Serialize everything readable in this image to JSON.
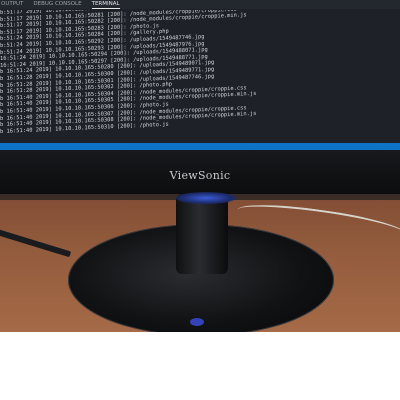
{
  "terminal": {
    "tabs": [
      "OUTPUT",
      "DEBUG CONSOLE",
      "TERMINAL"
    ],
    "active_tab": "TERMINAL",
    "lines": [
      "b:51:17 2019] 10.10.10.165:50280 [200]: /photo.js",
      "b:51:17 2019] 10.10.10.165:50281 [200]: /node_modules/croppie/croppie.css",
      "b:51:17 2019] 10.10.10.165:50282 [200]: /node_modules/croppie/croppie.min.js",
      "b:51:17 2019] 10.10.10.165:50283 [200]: /photo.js",
      "b:51:24 2019] 10.10.10.165:50284 [200]: /gallery.php",
      "b:51:24 2019] 10.10.10.165:50292 [200]: /uploads/1549487746.jpg",
      "b:51:24 2019] 10.10.10.165:50293 [200]: /uploads/1549487976.jpg",
      "16:51:24 2019] 10.10.10.165:50294 [200]: /uploads/1549488071.jpg",
      "16:51:24 2019] 10.10.10.165:50297 [200]: /uploads/1549488771.jpg",
      "b 16:51:24 2019] 10.10.10.165:50280 [200]: /uploads/1549489071.jpg",
      "b 16:51:28 2019] 10.10.10.165:50300 [200]: /uploads/1549489771.jpg",
      "b 16:51:28 2019] 10.10.10.165:50301 [200]: /uploads/1549487746.jpg",
      "b 16:51:28 2019] 10.10.10.165:50302 [200]: /photo.php",
      "b 16:51:40 2019] 10.10.10.165:50304 [200]: /node_modules/croppie/croppie.css",
      "b 16:51:40 2019] 10.10.10.165:50305 [200]: /node_modules/croppie/croppie.min.js",
      "b 16:51:40 2019] 10.10.10.165:50306 [200]: /photo.js",
      "b 16:51:40 2019] 10.10.10.165:50307 [200]: /node_modules/croppie/croppie.css",
      "b 16:51:40 2019] 10.10.10.165:50308 [200]: /node_modules/croppie/croppie.min.js",
      "b 16:51:40 2019] 10.10.10.165:50310 [200]: /photo.js"
    ]
  },
  "monitor": {
    "brand": "ViewSonic"
  },
  "colors": {
    "status_bar": "#0e72c6",
    "terminal_bg": "#1e2228",
    "power_led": "#3f4fe0"
  }
}
